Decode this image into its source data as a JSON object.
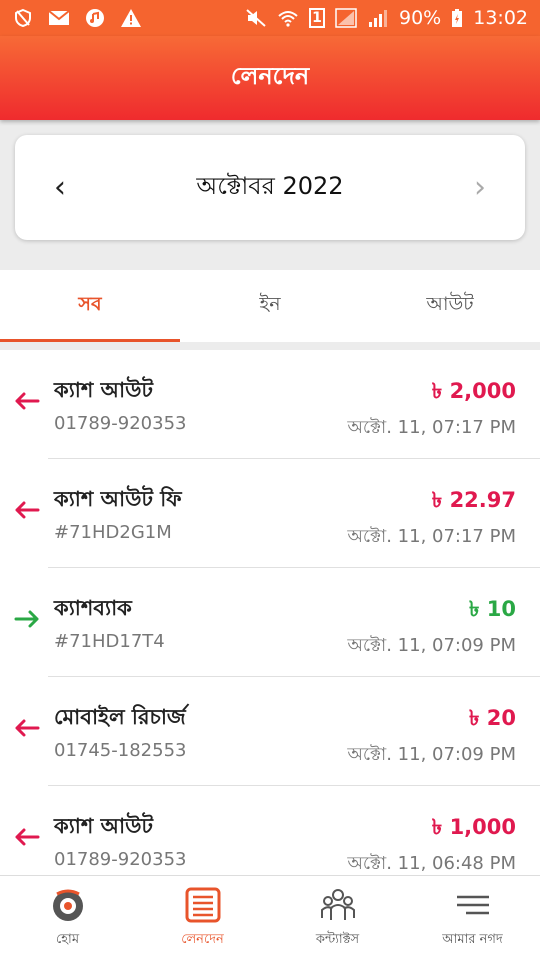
{
  "status_bar": {
    "battery": "90%",
    "time": "13:02",
    "sim_badge": "1",
    "icons": [
      "shield-icon",
      "mail-icon",
      "music-icon",
      "warning-icon",
      "mute-icon",
      "wifi-icon",
      "sim-icon",
      "signal-icon",
      "battery-icon"
    ]
  },
  "header": {
    "title": "লেনদেন"
  },
  "month_selector": {
    "prev": "‹",
    "month": "অক্টোবর 2022",
    "next": "›"
  },
  "tabs": [
    {
      "label": "সব",
      "active": true
    },
    {
      "label": "ইন",
      "active": false
    },
    {
      "label": "আউট",
      "active": false
    }
  ],
  "transactions": [
    {
      "name": "ক্যাশ আউট",
      "sub": "01789-920353",
      "amount": "৳ 2,000",
      "time": "অক্টো. 11, 07:17 PM",
      "direction": "out",
      "arrow_icon": "arrow-left-icon"
    },
    {
      "name": "ক্যাশ আউট ফি",
      "sub": "#71HD2G1M",
      "amount": "৳ 22.97",
      "time": "অক্টো. 11, 07:17 PM",
      "direction": "out",
      "arrow_icon": "arrow-left-icon"
    },
    {
      "name": "ক্যাশব্যাক",
      "sub": "#71HD17T4",
      "amount": "৳ 10",
      "time": "অক্টো. 11, 07:09 PM",
      "direction": "in",
      "arrow_icon": "arrow-right-icon"
    },
    {
      "name": "মোবাইল রিচার্জ",
      "sub": "01745-182553",
      "amount": "৳ 20",
      "time": "অক্টো. 11, 07:09 PM",
      "direction": "out",
      "arrow_icon": "arrow-left-icon"
    },
    {
      "name": "ক্যাশ আউট",
      "sub": "01789-920353",
      "amount": "৳ 1,000",
      "time": "অক্টো. 11, 06:48 PM",
      "direction": "out",
      "arrow_icon": "arrow-left-icon"
    }
  ],
  "bottom_nav": [
    {
      "label": "হোম",
      "icon": "home-icon",
      "active": false
    },
    {
      "label": "লেনদেন",
      "icon": "transactions-icon",
      "active": true
    },
    {
      "label": "কন্ট্যাক্টস",
      "icon": "contacts-icon",
      "active": false
    },
    {
      "label": "আমার নগদ",
      "icon": "menu-icon",
      "active": false
    }
  ],
  "colors": {
    "accent": "#e8542b",
    "out": "#e0194f",
    "in": "#2aa845",
    "header_top": "#f76a36",
    "header_bottom": "#ef2b2e"
  }
}
